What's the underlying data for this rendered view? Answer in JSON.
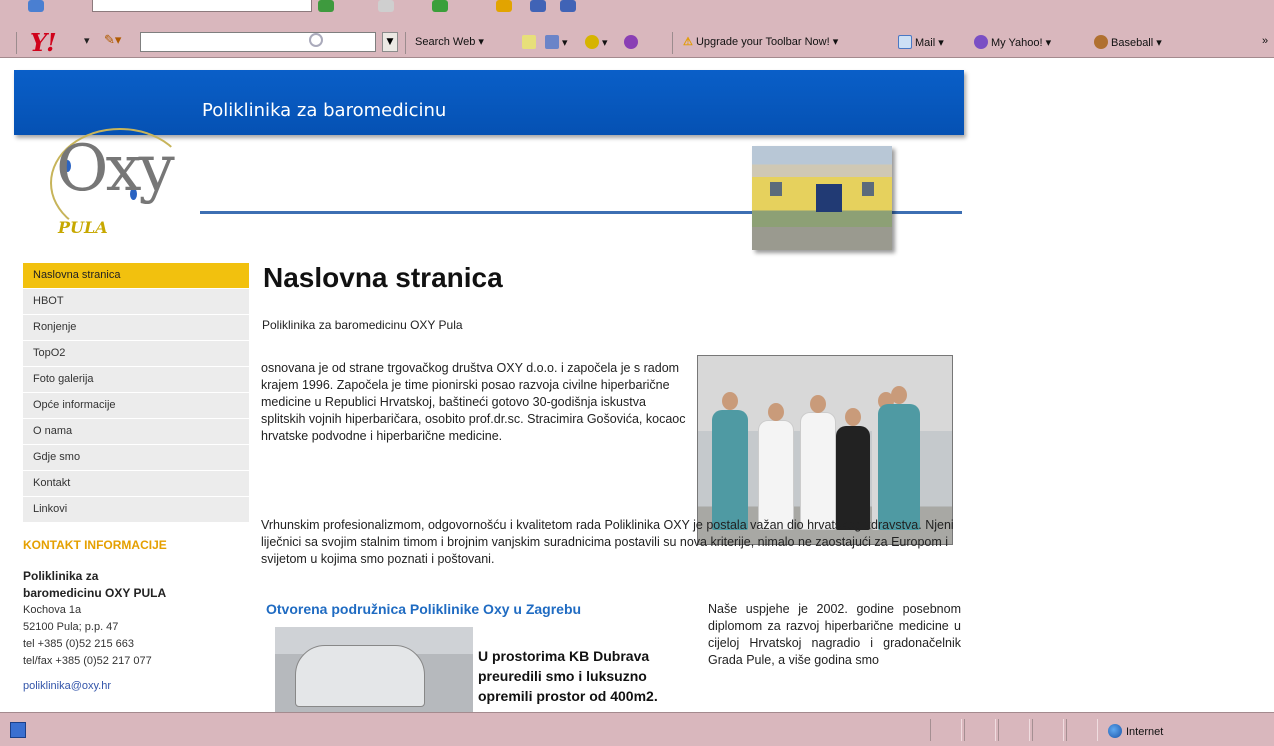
{
  "browser": {
    "toolbar": {
      "search_web": "Search Web",
      "upgrade": "Upgrade your Toolbar Now!",
      "mail": "Mail",
      "my_yahoo": "My Yahoo!",
      "baseball": "Baseball",
      "overflow": "»"
    },
    "status": {
      "zone": "Internet"
    }
  },
  "site": {
    "banner_title": "Poliklinika za baromedicinu",
    "logo_text": "Oxy",
    "logo_pula": "PULA"
  },
  "nav": {
    "items": [
      "Naslovna stranica",
      "HBOT",
      "Ronjenje",
      "TopO2",
      "Foto galerija",
      "Opće informacije",
      "O nama",
      "Gdje smo",
      "Kontakt",
      "Linkovi"
    ],
    "active_index": 0
  },
  "contact": {
    "heading": "KONTAKT INFORMACIJE",
    "name_line1": "Poliklinika za",
    "name_line2": "baromedicinu OXY PULA",
    "street": "Kochova 1a",
    "city": "52100 Pula; p.p. 47",
    "tel": "tel +385 (0)52 215 663",
    "telfax": "tel/fax +385 (0)52 217 077",
    "email": "poliklinika@oxy.hr"
  },
  "main": {
    "title": "Naslovna stranica",
    "subtitle": "Poliklinika za baromedicinu OXY Pula",
    "para1": "osnovana je od strane trgovačkog društva OXY d.o.o. i započela je s radom krajem 1996. Započela je time pionirski posao razvoja civilne hiperbarične medicine u Republici Hrvatskoj, baštineći gotovo 30-godišnja iskustva splitskih vojnih hiperbaričara, osobito prof.dr.sc. Stracimira Gošovića, kocaoc hrvatske podvodne i hiperbarične medicine.",
    "para2": "Vrhunskim profesionalizmom, odgovornošću i kvalitetom rada Poliklinika OXY je postala važan dio hrvatskog zdravstva. Njeni liječnici sa svojim stalnim timom i brojnim vanjskim suradnicima postavili su nova kriterije, nimalo ne zaostajući za Europom i svijetom u kojima smo poznati i poštovani.",
    "zagreb_link": "Otvorena podružnica Poliklinike Oxy u Zagrebu",
    "zagreb_text": "U prostorima KB Dubrava preuredili smo i luksuzno opremili prostor od 400m2.",
    "right_col": "Naše uspjehe je 2002. godine posebnom diplomom za razvoj hiperbarične medicine u cijeloj Hrvatskoj nagradio i gradonačelnik Grada Pule, a više godina smo"
  }
}
